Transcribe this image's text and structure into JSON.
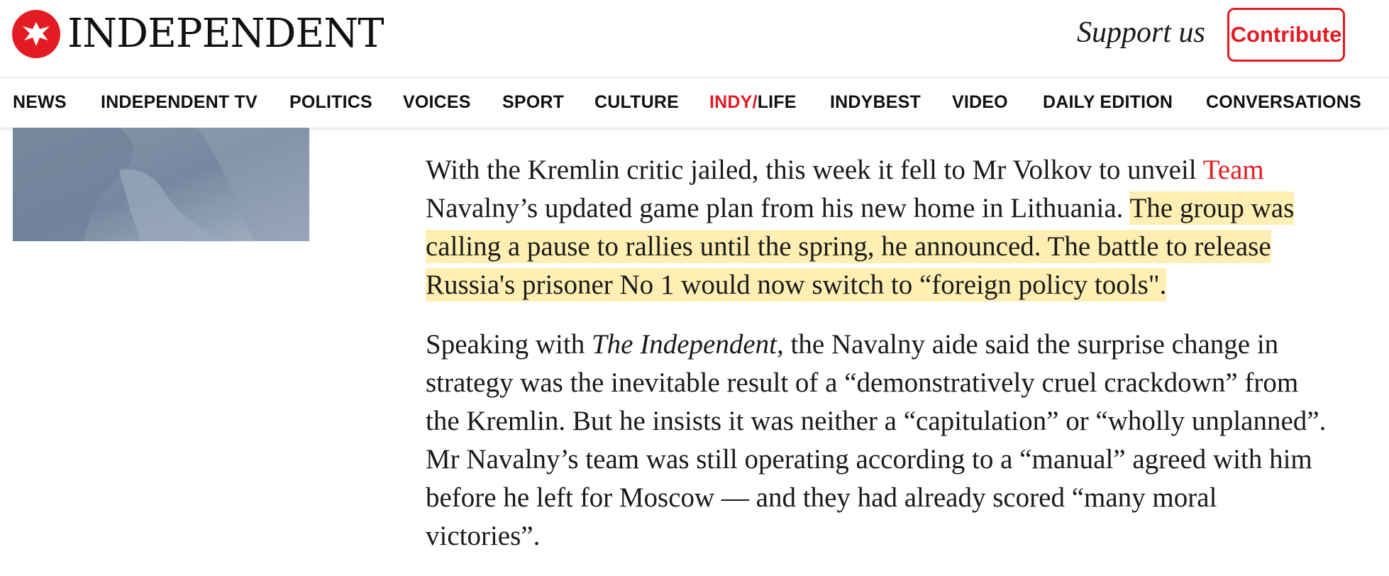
{
  "header": {
    "logo_text": "INDEPENDENT",
    "support_text": "Support us",
    "contribute_label": "Contribute"
  },
  "nav": {
    "items": [
      {
        "label": "NEWS"
      },
      {
        "label": "INDEPENDENT TV"
      },
      {
        "label": "POLITICS"
      },
      {
        "label": "VOICES"
      },
      {
        "label": "SPORT"
      },
      {
        "label": "CULTURE"
      },
      {
        "label_red": "INDY/",
        "label": "LIFE"
      },
      {
        "label": "INDYBEST"
      },
      {
        "label": "VIDEO"
      },
      {
        "label": "DAILY EDITION"
      },
      {
        "label": "CONVERSATIONS"
      }
    ]
  },
  "article": {
    "p1_text_a": "With the Kremlin critic jailed, this week it fell to Mr Volkov to unveil ",
    "p1_link": "Team",
    "p1_text_b": "Navalny’s updated game plan from his new home in Lithuania. ",
    "p1_highlight": "The group was calling a pause to rallies until the spring, he announced. The battle to release Russia's prisoner No 1 would now switch to “foreign policy tools\".",
    "p2_text_a": "Speaking with ",
    "p2_italic": "The Independent,",
    "p2_text_b": " the Navalny aide said the surprise change in strategy was the inevitable result of a “demonstratively cruel crackdown” from the Kremlin. But he insists it was neither a “capitulation” or “wholly unplanned”. Mr Navalny’s team was still operating according to a “manual” agreed with him before he left for Moscow — and they had already scored “many moral victories”."
  },
  "colors": {
    "brand_red": "#e31b23",
    "highlight": "#ffefb3"
  }
}
